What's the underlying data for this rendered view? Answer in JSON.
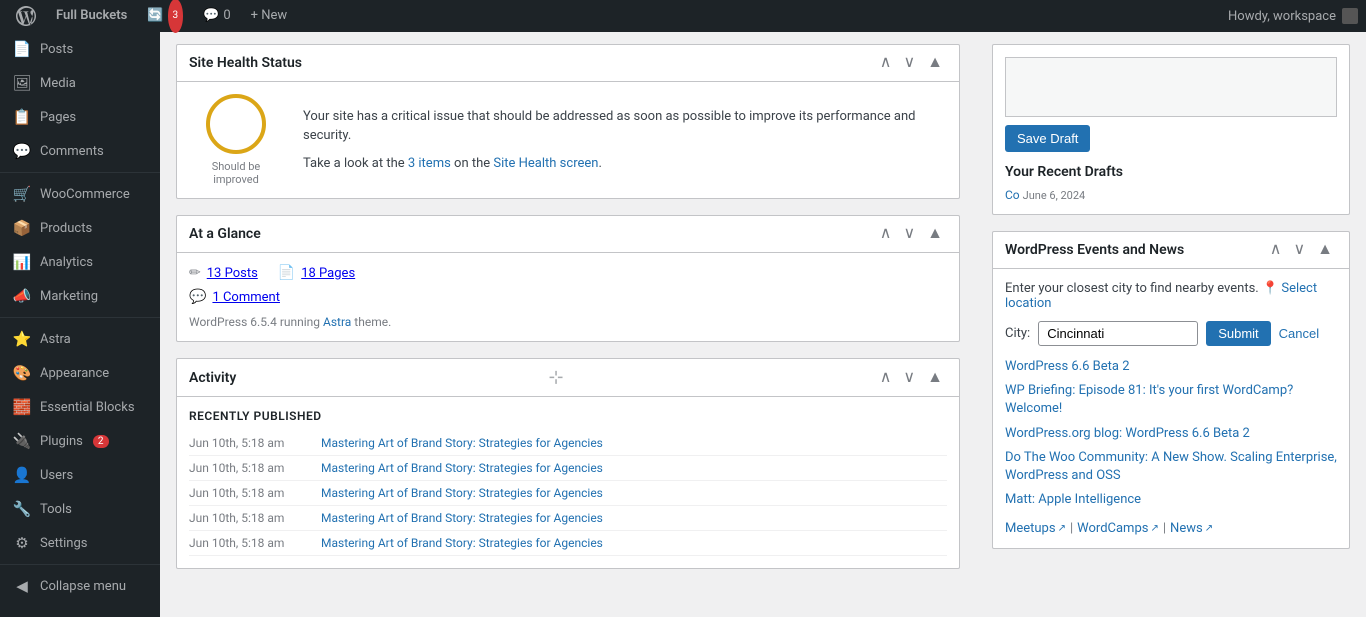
{
  "adminbar": {
    "wp_label": "WordPress",
    "site_name": "Full Buckets",
    "updates": "3",
    "comments_count": "0",
    "new_label": "+ New",
    "howdy": "Howdy, workspace"
  },
  "sidebar": {
    "items": [
      {
        "id": "posts",
        "label": "Posts",
        "icon": "📄"
      },
      {
        "id": "media",
        "label": "Media",
        "icon": "🖼"
      },
      {
        "id": "pages",
        "label": "Pages",
        "icon": "📋"
      },
      {
        "id": "comments",
        "label": "Comments",
        "icon": "💬"
      },
      {
        "id": "woocommerce",
        "label": "WooCommerce",
        "icon": "🛒"
      },
      {
        "id": "products",
        "label": "Products",
        "icon": "📦"
      },
      {
        "id": "analytics",
        "label": "Analytics",
        "icon": "📊"
      },
      {
        "id": "marketing",
        "label": "Marketing",
        "icon": "📣"
      },
      {
        "id": "astra",
        "label": "Astra",
        "icon": "⭐"
      },
      {
        "id": "appearance",
        "label": "Appearance",
        "icon": "🎨"
      },
      {
        "id": "essential-blocks",
        "label": "Essential Blocks",
        "icon": "🧱"
      },
      {
        "id": "plugins",
        "label": "Plugins",
        "icon": "🔌",
        "badge": "2"
      },
      {
        "id": "users",
        "label": "Users",
        "icon": "👤"
      },
      {
        "id": "tools",
        "label": "Tools",
        "icon": "🔧"
      },
      {
        "id": "settings",
        "label": "Settings",
        "icon": "⚙"
      }
    ],
    "collapse_label": "Collapse menu"
  },
  "site_health": {
    "title": "Site Health Status",
    "status_label": "Should be improved",
    "message": "Your site has a critical issue that should be addressed as soon as possible to improve its performance and security.",
    "items_text": "Take a look at the ",
    "items_count": "3",
    "items_label": " items",
    "items_link_text": " on the ",
    "screen_link": "Site Health screen",
    "period": "."
  },
  "at_a_glance": {
    "title": "At a Glance",
    "posts_count": "13 Posts",
    "pages_count": "18 Pages",
    "comments_count": "1 Comment",
    "version_text": "WordPress 6.5.4 running ",
    "theme_link": "Astra",
    "theme_suffix": " theme."
  },
  "activity": {
    "title": "Activity",
    "recently_published_label": "Recently Published",
    "items": [
      {
        "time": "Jun 10th, 5:18 am",
        "title": "Mastering Art of Brand Story: Strategies for Agencies"
      },
      {
        "time": "Jun 10th, 5:18 am",
        "title": "Mastering Art of Brand Story: Strategies for Agencies"
      },
      {
        "time": "Jun 10th, 5:18 am",
        "title": "Mastering Art of Brand Story: Strategies for Agencies"
      },
      {
        "time": "Jun 10th, 5:18 am",
        "title": "Mastering Art of Brand Story: Strategies for Agencies"
      },
      {
        "time": "Jun 10th, 5:18 am",
        "title": "Mastering Art of Brand Story: Strategies for Agencies"
      }
    ]
  },
  "right_panel": {
    "save_draft_label": "Save Draft",
    "drafts_title": "Your Recent Drafts",
    "draft_link": "Co",
    "draft_date": "June 6, 2024",
    "events_title": "WordPress Events and News",
    "events_intro": "Enter your closest city to find nearby events.",
    "select_location_label": "Select location",
    "city_label": "City:",
    "city_value": "Cincinnati",
    "city_placeholder": "Cincinnati",
    "submit_label": "Submit",
    "cancel_label": "Cancel",
    "news_links": [
      {
        "text": "WordPress 6.6 Beta 2",
        "url": "#"
      },
      {
        "text": "WP Briefing: Episode 81: It's your first WordCamp? Welcome!",
        "url": "#"
      },
      {
        "text": "WordPress.org blog: WordPress 6.6 Beta 2",
        "url": "#"
      },
      {
        "text": "Do The Woo Community: A New Show. Scaling Enterprise, WordPress and OSS",
        "url": "#"
      },
      {
        "text": "Matt: Apple Intelligence",
        "url": "#"
      }
    ],
    "footer_links": [
      {
        "label": "Meetups",
        "url": "#"
      },
      {
        "label": "WordCamps",
        "url": "#"
      },
      {
        "label": "News",
        "url": "#"
      }
    ]
  }
}
